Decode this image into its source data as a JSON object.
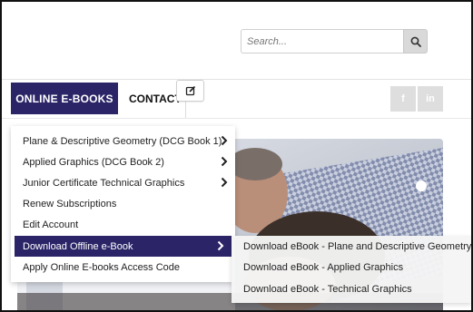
{
  "search": {
    "placeholder": "Search...",
    "icon": "search-icon"
  },
  "nav": {
    "ebooks_label": "ONLINE E-BOOKS",
    "contact_label": "CONTACT",
    "edit_icon": "edit-icon",
    "social": [
      {
        "label": "f",
        "icon": "facebook-icon"
      },
      {
        "label": "in",
        "icon": "linkedin-icon"
      }
    ]
  },
  "colors": {
    "accent": "#2b2567",
    "social_bg": "#dedede"
  },
  "dropdown": {
    "items": [
      {
        "label": "Plane & Descriptive Geometry (DCG Book 1)",
        "has_submenu": true
      },
      {
        "label": "Applied Graphics (DCG Book 2)",
        "has_submenu": true
      },
      {
        "label": "Junior Certificate Technical Graphics",
        "has_submenu": true
      },
      {
        "label": "Renew Subscriptions",
        "has_submenu": false
      },
      {
        "label": "Edit Account",
        "has_submenu": false
      },
      {
        "label": "Download Offline e-Book",
        "has_submenu": true,
        "active": true
      },
      {
        "label": "Apply Online E-books Access Code",
        "has_submenu": false
      }
    ]
  },
  "submenu": {
    "items": [
      {
        "label": "Download eBook - Plane and Descriptive Geometry"
      },
      {
        "label": "Download eBook - Applied Graphics"
      },
      {
        "label": "Download eBook - Technical Graphics"
      }
    ]
  }
}
